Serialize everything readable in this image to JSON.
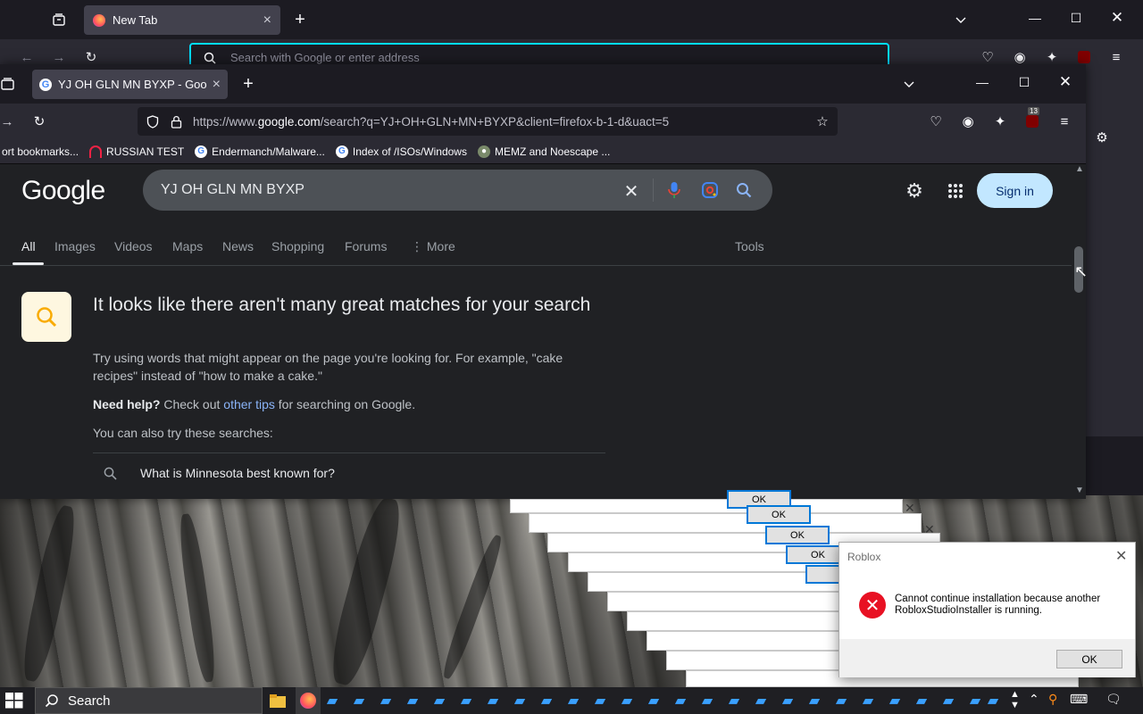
{
  "back_window": {
    "tab_title": "New Tab",
    "url_placeholder": "Search with Google or enter address"
  },
  "front_window": {
    "tab_title": "YJ OH GLN MN BYXP - Google",
    "url_prefix": "https://www.",
    "url_host": "google.com",
    "url_rest": "/search?q=YJ+OH+GLN+MN+BYXP&client=firefox-b-1-d&uact=5",
    "badge_count": "13",
    "bookmarks": [
      {
        "label": "ort bookmarks..."
      },
      {
        "label": "RUSSIAN TEST"
      },
      {
        "label": "Endermanch/Malware..."
      },
      {
        "label": "Index of /ISOs/Windows"
      },
      {
        "label": "MEMZ and Noescape ..."
      }
    ]
  },
  "google": {
    "logo": "Google",
    "query": "YJ OH GLN MN BYXP",
    "sign_in": "Sign in",
    "tabs": [
      "All",
      "Images",
      "Videos",
      "Maps",
      "News",
      "Shopping",
      "Forums",
      "More"
    ],
    "tools": "Tools",
    "heading": "It looks like there aren't many great matches for your search",
    "tip": "Try using words that might appear on the page you're looking for. For example, \"cake recipes\" instead of \"how to make a cake.\"",
    "help_bold": "Need help?",
    "help_pre": " Check out ",
    "help_link": "other tips",
    "help_post": " for searching on Google.",
    "also_try": "You can also try these searches:",
    "suggestion": "What is Minnesota best known for?"
  },
  "stacked_dialogs": {
    "ok_label": "OK"
  },
  "roblox_dialog": {
    "title": "Roblox",
    "message": "Cannot continue installation because another RobloxStudioInstaller is running.",
    "ok_label": "OK"
  },
  "taskbar": {
    "search_label": "Search"
  },
  "colors": {
    "accent_blue": "#8ab4f8",
    "signin_bg": "#c2e7ff",
    "error_red": "#e81123",
    "firefox_cyan": "#00ddff"
  }
}
